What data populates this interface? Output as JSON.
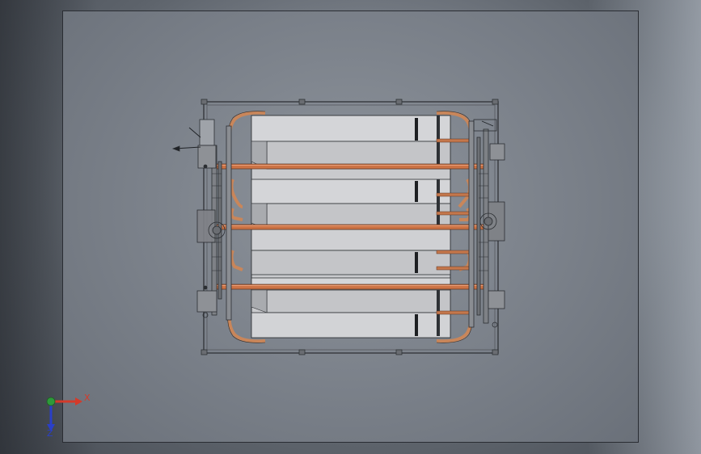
{
  "viewport": {
    "background_color": "#7c828b",
    "sheet_border_color": "#2a2d33"
  },
  "triad": {
    "x_label": "X",
    "z_label": "Z",
    "x_color": "#d43a2a",
    "z_color": "#2a3fc8",
    "origin_color": "#2e9a3a"
  },
  "model": {
    "pipe_color": "#d07a4a",
    "panel_color": "#c8c9cc",
    "frame_color": "#3a3d42",
    "pipe_rows": 3,
    "panels": 3
  }
}
